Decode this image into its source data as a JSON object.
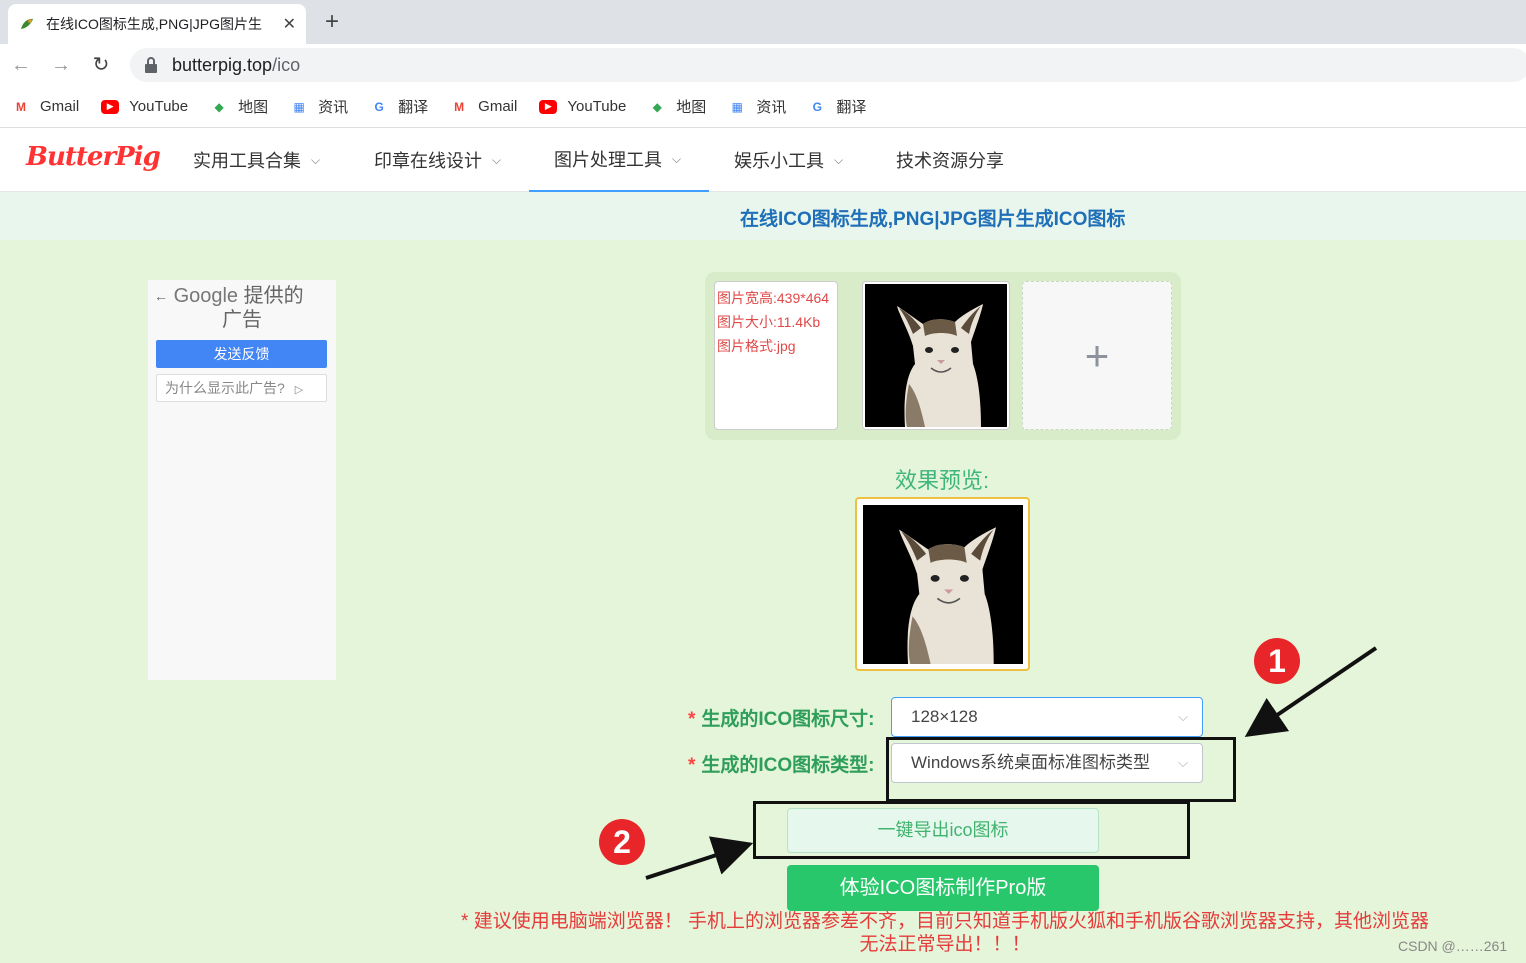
{
  "browser": {
    "tab_title": "在线ICO图标生成,PNG|JPG图片生",
    "url_host": "butterpig.top",
    "url_path": "/ico",
    "bookmarks": [
      {
        "label": "Gmail",
        "icon": "gmail-icon",
        "color": "#ea4335"
      },
      {
        "label": "YouTube",
        "icon": "youtube-icon",
        "color": "#ff0000"
      },
      {
        "label": "地图",
        "icon": "maps-icon",
        "color": "#34a853"
      },
      {
        "label": "资讯",
        "icon": "news-icon",
        "color": "#4285f4"
      },
      {
        "label": "翻译",
        "icon": "translate-icon",
        "color": "#4285f4"
      },
      {
        "label": "Gmail",
        "icon": "gmail-icon",
        "color": "#ea4335"
      },
      {
        "label": "YouTube",
        "icon": "youtube-icon",
        "color": "#ff0000"
      },
      {
        "label": "地图",
        "icon": "maps-icon",
        "color": "#34a853"
      },
      {
        "label": "资讯",
        "icon": "news-icon",
        "color": "#4285f4"
      },
      {
        "label": "翻译",
        "icon": "translate-icon",
        "color": "#4285f4"
      }
    ]
  },
  "site": {
    "logo": "ButterPig",
    "menu": [
      {
        "label": "实用工具合集",
        "has_dropdown": true
      },
      {
        "label": "印章在线设计",
        "has_dropdown": true
      },
      {
        "label": "图片处理工具",
        "has_dropdown": true,
        "active": true
      },
      {
        "label": "娱乐小工具",
        "has_dropdown": true
      },
      {
        "label": "技术资源分享",
        "has_dropdown": false
      }
    ],
    "page_heading": "在线ICO图标生成,PNG|JPG图片生成ICO图标"
  },
  "ad": {
    "google": "Google",
    "provided_by": "提供的",
    "ad_word": "广告",
    "feedback_button": "发送反馈",
    "why_button": "为什么显示此广告?"
  },
  "upload": {
    "info_size": "图片宽高:439*464",
    "info_filesize": "图片大小:11.4Kb",
    "info_format": "图片格式:jpg",
    "add_symbol": "+"
  },
  "preview": {
    "label": "效果预览:"
  },
  "form": {
    "size_label": "生成的ICO图标尺寸:",
    "size_value": "128×128",
    "type_label": "生成的ICO图标类型:",
    "type_value": "Windows系统桌面标准图标类型",
    "required_mark": "*"
  },
  "buttons": {
    "export": "一键导出ico图标",
    "pro": "体验ICO图标制作Pro版"
  },
  "warning": "* 建议使用电脑端浏览器！ 手机上的浏览器参差不齐，目前只知道手机版火狐和手机版谷歌浏览器支持，其他浏览器无法正常导出！！！",
  "annotations": {
    "marker_1": "1",
    "marker_2": "2"
  },
  "watermark": "CSDN @……261",
  "colors": {
    "page_bg": "#e5f5d9",
    "accent_green": "#28c76b",
    "warn_red": "#e63b3b",
    "heading_blue": "#1e6fb8"
  }
}
